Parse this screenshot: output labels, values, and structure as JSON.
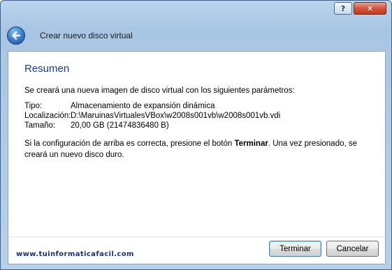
{
  "titlebar": {
    "help_label": "?",
    "close_label": "✕"
  },
  "header": {
    "back_icon": "back-arrow-icon",
    "title": "Crear nuevo disco virtual"
  },
  "page": {
    "heading": "Resumen",
    "intro": "Se creará una nueva imagen de disco virtual con los siguientes parámetros:",
    "params": [
      {
        "label": "Tipo:",
        "value": "Almacenamiento de expansión dinámica"
      },
      {
        "label": "Localización:",
        "value": "D:\\MaruinasVirtualesVBox\\w2008s001vb\\w2008s001vb.vdi"
      },
      {
        "label": "Tamaño:",
        "value": "20,00 GB (21474836480 B)"
      }
    ],
    "outro_before": "Si la configuración de arriba es correcta, presione el botón ",
    "outro_bold": "Terminar",
    "outro_after": ". Una vez presionado, se creará un nuevo disco duro."
  },
  "footer": {
    "watermark": "www.tuinformaticafacil.com"
  },
  "buttons": {
    "finish": "Terminar",
    "cancel": "Cancelar"
  },
  "colors": {
    "heading": "#1a3e8a",
    "close_button": "#c23b20",
    "primary_border": "#3c7fb1"
  }
}
